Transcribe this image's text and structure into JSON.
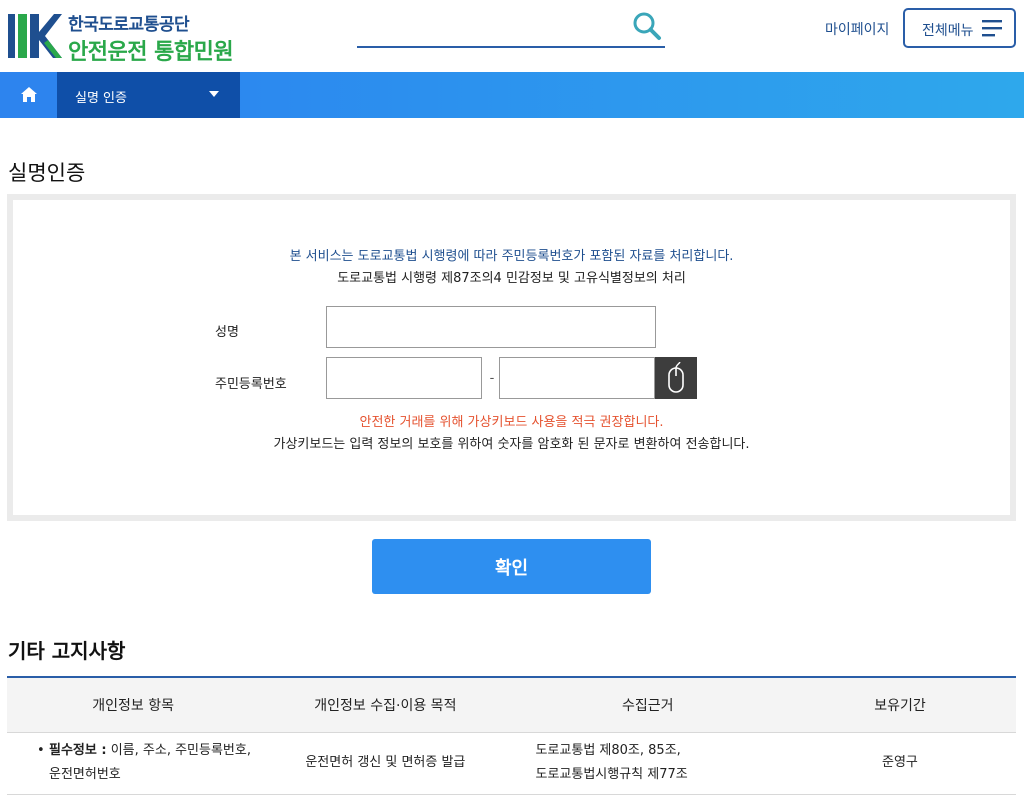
{
  "header": {
    "logo_line1": "한국도로교통공단",
    "logo_line2": "안전운전 통합민원",
    "search_placeholder": "",
    "mypage_label": "마이페이지",
    "menu_label": "전체메뉴"
  },
  "nav": {
    "dropdown_label": "실명 인증"
  },
  "auth": {
    "title": "실명인증",
    "notice_blue": "본 서비스는 도로교통법 시행령에 따라 주민등록번호가 포함된 자료를 처리합니다.",
    "notice_black": "도로교통법 시행령 제87조의4 민감정보 및 고유식별정보의 처리",
    "name_label": "성명",
    "rrn_label": "주민등록번호",
    "rrn_dash": "-",
    "notice_red": "안전한 거래를 위해 가상키보드 사용을 적극 권장합니다.",
    "notice_vkb": "가상키보드는 입력 정보의 보호를 위하여 숫자를 암호화 된 문자로 변환하여 전송합니다.",
    "confirm_label": "확인"
  },
  "notices": {
    "title": "기타 고지사항",
    "columns": [
      "개인정보 항목",
      "개인정보 수집·이용 목적",
      "수집근거",
      "보유기간"
    ],
    "rows": [
      {
        "item_bullet": "•",
        "item_bold": "필수정보 :",
        "item_text1": " 이름, 주소, 주민등록번호,",
        "item_text2": "운전면허번호",
        "purpose": "운전면허 갱신 및 면허증 발급",
        "basis1": "도로교통법 제80조, 85조,",
        "basis2": "도로교통법시행규칙 제77조",
        "retention": "준영구"
      }
    ]
  },
  "colors": {
    "primary": "#2e8ff0",
    "nav_dark": "#0f4fa8",
    "brand_blue": "#1f4f8f",
    "brand_green": "#2aa84a",
    "warn_red": "#e5522f"
  }
}
